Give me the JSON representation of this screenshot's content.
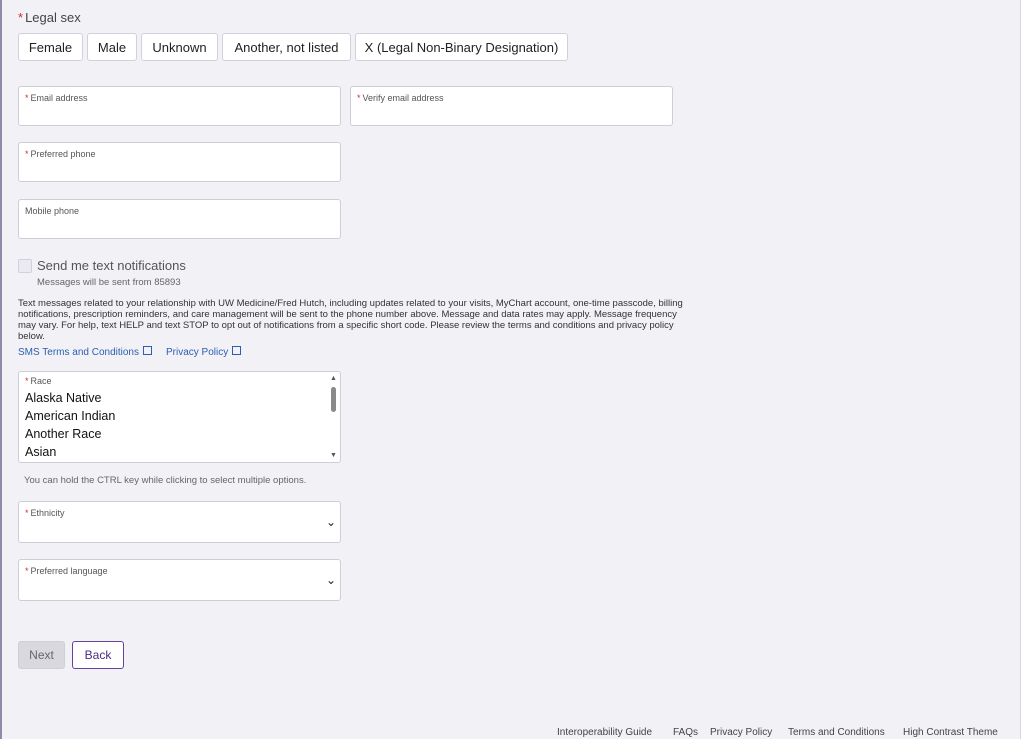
{
  "legal_sex": {
    "label": "Legal sex",
    "options": [
      "Female",
      "Male",
      "Unknown",
      "Another, not listed",
      "X (Legal Non-Binary Designation)"
    ]
  },
  "fields": {
    "email_label": "Email address",
    "verify_email_label": "Verify email address",
    "preferred_phone_label": "Preferred phone",
    "mobile_phone_label": "Mobile phone",
    "race_label": "Race",
    "ethnicity_label": "Ethnicity",
    "language_label": "Preferred language"
  },
  "notifications": {
    "checkbox_label": "Send me text notifications",
    "sender_note": "Messages will be sent from 85893",
    "disclaimer": "Text messages related to your relationship with UW Medicine/Fred Hutch, including updates related to your visits, MyChart account, one-time passcode, billing notifications, prescription reminders, and care management will be sent to the phone number above. Message and data rates may apply. Message frequency may vary. For help, text HELP and text STOP to opt out of notifications from a specific short code. Please review the terms and conditions and privacy policy below.",
    "sms_terms_link": "SMS Terms and Conditions",
    "privacy_link": "Privacy Policy"
  },
  "race_options": [
    "Alaska Native",
    "American Indian",
    "Another Race",
    "Asian"
  ],
  "race_hint": "You can hold the CTRL key while clicking to select multiple options.",
  "buttons": {
    "next": "Next",
    "back": "Back"
  },
  "footer": [
    "Interoperability Guide",
    "FAQs",
    "Privacy Policy",
    "Terms and Conditions",
    "High Contrast Theme"
  ],
  "icons": {
    "chevron": "chevron-down-icon",
    "external": "external-link-icon"
  }
}
